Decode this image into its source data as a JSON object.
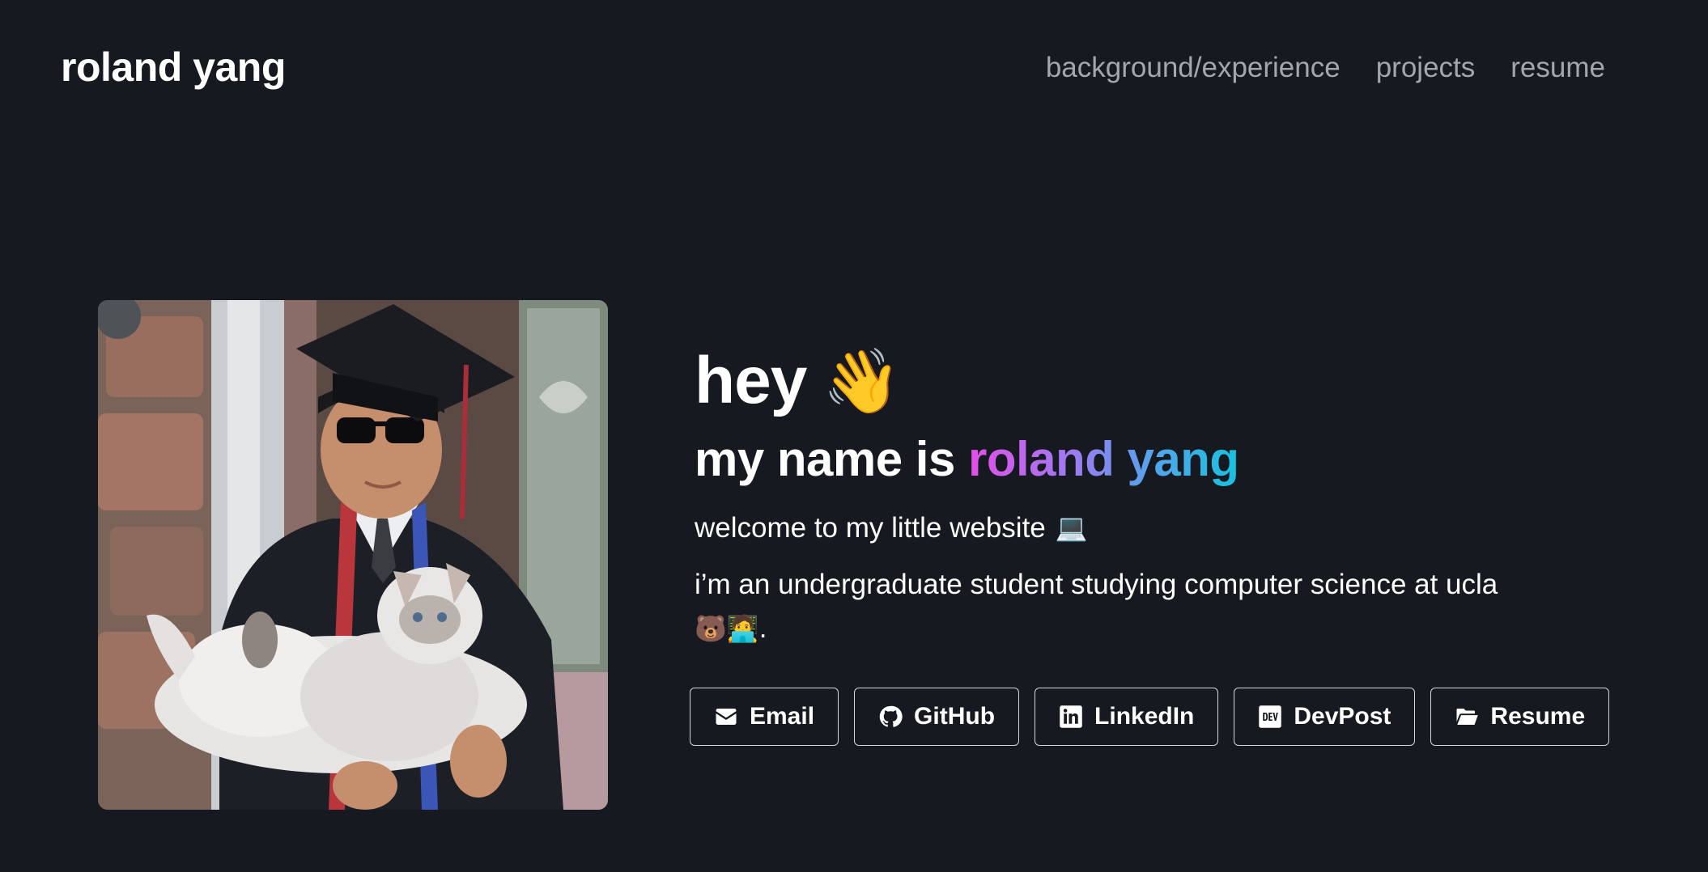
{
  "header": {
    "brand": "roland yang",
    "nav": [
      {
        "label": "background/experience"
      },
      {
        "label": "projects"
      },
      {
        "label": "resume"
      }
    ]
  },
  "photo": {
    "alt": "roland yang in graduation cap and gown holding a fluffy cat"
  },
  "intro": {
    "greeting": "hey",
    "greeting_emoji": "👋",
    "name_prefix": "my name is",
    "name_first": "roland",
    "name_last": "yang",
    "welcome": "welcome to my little website",
    "welcome_emoji": "💻",
    "bio": "i’m an undergraduate student studying computer science at ucla",
    "bio_emojis": "🐻🧑‍💻",
    "bio_period": "."
  },
  "buttons": [
    {
      "label": "Email",
      "icon": "envelope-icon"
    },
    {
      "label": "GitHub",
      "icon": "github-icon"
    },
    {
      "label": "LinkedIn",
      "icon": "linkedin-icon"
    },
    {
      "label": "DevPost",
      "icon": "devpost-icon"
    },
    {
      "label": "Resume",
      "icon": "folder-open-icon"
    }
  ],
  "colors": {
    "background": "#171920",
    "nav_text": "#a3a6ad",
    "gradient_start": "#e34fe9",
    "gradient_end": "#18c1de"
  }
}
